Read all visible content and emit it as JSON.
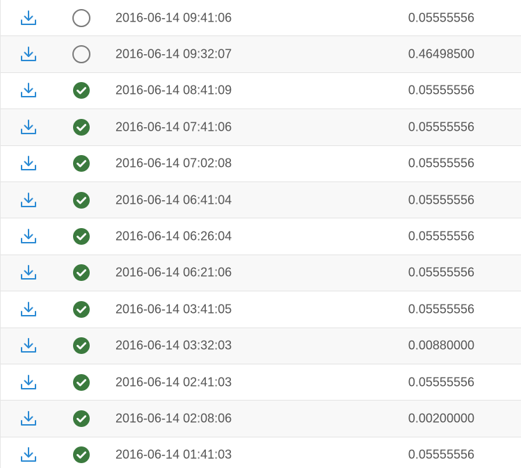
{
  "colors": {
    "download_icon": "#2a8ad4",
    "confirmed": "#3b7a3e",
    "pending_ring": "#7a7a7a",
    "text": "#555555",
    "row_alt_bg": "#f8f8f8"
  },
  "transactions": [
    {
      "status": "pending",
      "status_icon": "empty-circle-icon",
      "timestamp": "2016-06-14 09:41:06",
      "amount": "0.05555556"
    },
    {
      "status": "pending",
      "status_icon": "empty-circle-icon",
      "timestamp": "2016-06-14 09:32:07",
      "amount": "0.46498500"
    },
    {
      "status": "confirmed",
      "status_icon": "check-circle-icon",
      "timestamp": "2016-06-14 08:41:09",
      "amount": "0.05555556"
    },
    {
      "status": "confirmed",
      "status_icon": "check-circle-icon",
      "timestamp": "2016-06-14 07:41:06",
      "amount": "0.05555556"
    },
    {
      "status": "confirmed",
      "status_icon": "check-circle-icon",
      "timestamp": "2016-06-14 07:02:08",
      "amount": "0.05555556"
    },
    {
      "status": "confirmed",
      "status_icon": "check-circle-icon",
      "timestamp": "2016-06-14 06:41:04",
      "amount": "0.05555556"
    },
    {
      "status": "confirmed",
      "status_icon": "check-circle-icon",
      "timestamp": "2016-06-14 06:26:04",
      "amount": "0.05555556"
    },
    {
      "status": "confirmed",
      "status_icon": "check-circle-icon",
      "timestamp": "2016-06-14 06:21:06",
      "amount": "0.05555556"
    },
    {
      "status": "confirmed",
      "status_icon": "check-circle-icon",
      "timestamp": "2016-06-14 03:41:05",
      "amount": "0.05555556"
    },
    {
      "status": "confirmed",
      "status_icon": "check-circle-icon",
      "timestamp": "2016-06-14 03:32:03",
      "amount": "0.00880000"
    },
    {
      "status": "confirmed",
      "status_icon": "check-circle-icon",
      "timestamp": "2016-06-14 02:41:03",
      "amount": "0.05555556"
    },
    {
      "status": "confirmed",
      "status_icon": "check-circle-icon",
      "timestamp": "2016-06-14 02:08:06",
      "amount": "0.00200000"
    },
    {
      "status": "confirmed",
      "status_icon": "check-circle-icon",
      "timestamp": "2016-06-14 01:41:03",
      "amount": "0.05555556"
    }
  ]
}
